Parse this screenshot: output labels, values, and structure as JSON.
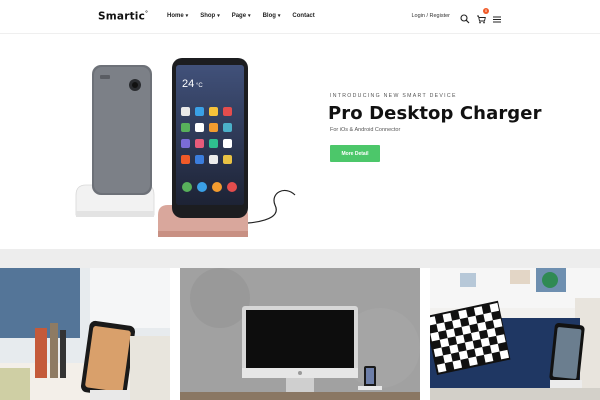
{
  "brand": {
    "name": "Smartic"
  },
  "nav": {
    "items": [
      {
        "label": "Home"
      },
      {
        "label": "Shop"
      },
      {
        "label": "Page"
      },
      {
        "label": "Blog"
      },
      {
        "label": "Contact"
      }
    ]
  },
  "account": {
    "label": "Login / Register"
  },
  "cart": {
    "count": "0"
  },
  "hero": {
    "eyebrow": "INTRODUCING NEW SMART DEVICE",
    "title": "Pro Desktop Charger",
    "subtitle": "For iOs & Android Connector",
    "cta": "More Detail",
    "phone_time": "24",
    "phone_unit": "°C"
  },
  "colors": {
    "accent": "#4cc76a",
    "badge": "#f05a28",
    "strip": "#ededed"
  },
  "icons": {
    "search": "search-icon",
    "cart": "cart-icon",
    "menu": "menu-icon"
  }
}
